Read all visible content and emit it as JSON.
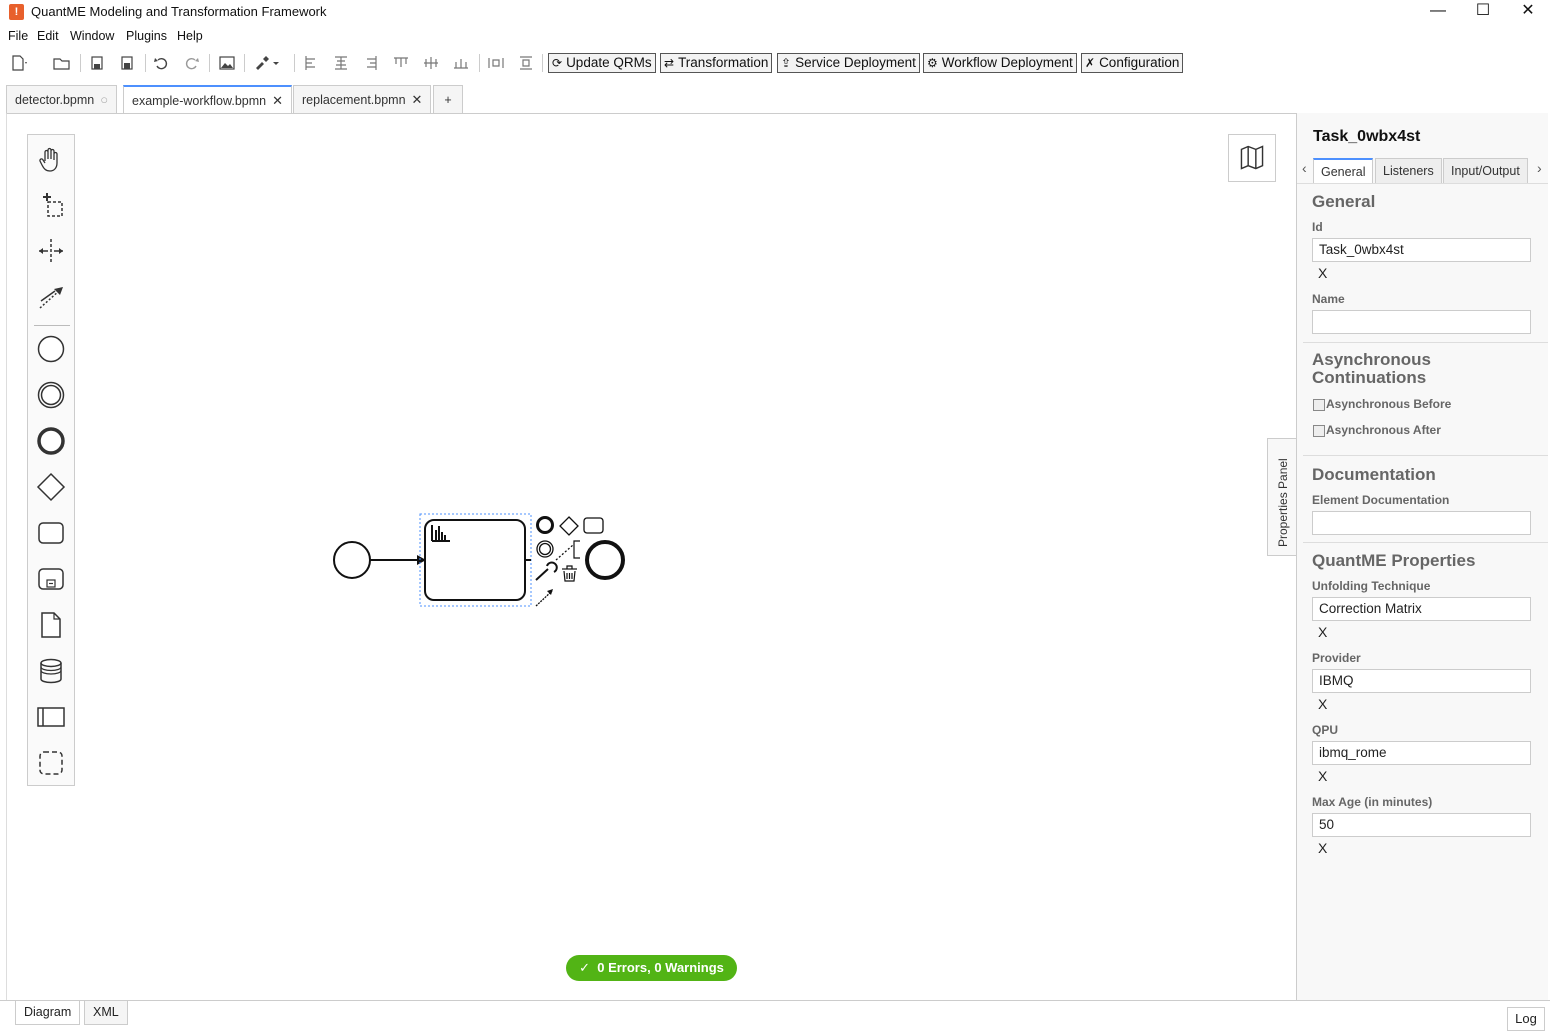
{
  "window": {
    "title": "QuantME Modeling and Transformation Framework",
    "app_icon_glyph": "!",
    "controls": {
      "minimize": "—",
      "maximize": "☐",
      "close": "✕"
    }
  },
  "menu": [
    "File",
    "Edit",
    "Window",
    "Plugins",
    "Help"
  ],
  "toolbar": {
    "buttons": [
      {
        "label": "Update QRMs",
        "icon": "refresh-icon"
      },
      {
        "label": "Transformation",
        "icon": "transform-icon"
      },
      {
        "label": "Service Deployment",
        "icon": "upload-icon"
      },
      {
        "label": "Workflow Deployment",
        "icon": "gear-icon"
      },
      {
        "label": "Configuration",
        "icon": "tools-icon"
      }
    ]
  },
  "tabs": [
    {
      "label": "detector.bpmn",
      "close": "○"
    },
    {
      "label": "example-workflow.bpmn",
      "close": "✕",
      "active": true
    },
    {
      "label": "replacement.bpmn",
      "close": "✕"
    }
  ],
  "new_tab": "+",
  "status": {
    "badge": "0 Errors, 0 Warnings",
    "check": "✓"
  },
  "bottom_tabs": [
    "Diagram",
    "XML"
  ],
  "log_button": "Log",
  "properties_panel": {
    "toggle_label": "Properties Panel",
    "title": "Task_0wbx4st",
    "tabs": [
      "General",
      "Listeners",
      "Input/Output"
    ],
    "sections": {
      "general": {
        "title": "General",
        "id_label": "Id",
        "id_value": "Task_0wbx4st",
        "name_label": "Name",
        "name_value": ""
      },
      "async": {
        "title_line1": "Asynchronous",
        "title_line2": "Continuations",
        "before_label": "Asynchronous Before",
        "after_label": "Asynchronous After"
      },
      "documentation": {
        "title": "Documentation",
        "element_doc_label": "Element Documentation",
        "element_doc_value": ""
      },
      "quantme": {
        "title": "QuantME Properties",
        "unfolding_label": "Unfolding Technique",
        "unfolding_value": "Correction Matrix",
        "provider_label": "Provider",
        "provider_value": "IBMQ",
        "qpu_label": "QPU",
        "qpu_value": "ibmq_rome",
        "max_age_label": "Max Age (in minutes)",
        "max_age_value": "50"
      }
    },
    "clear_glyph": "X"
  }
}
